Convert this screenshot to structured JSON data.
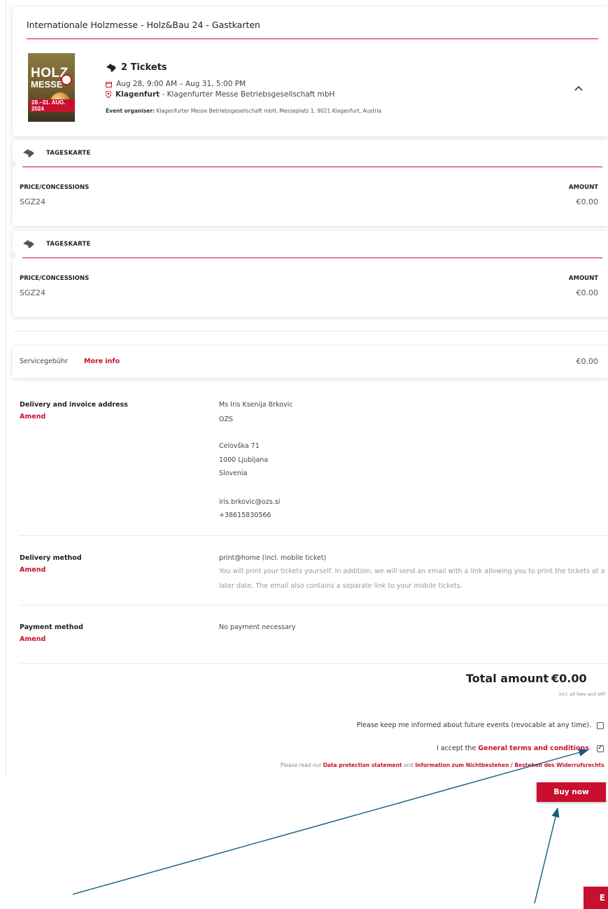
{
  "event": {
    "title": "Internationale Holzmesse - Holz&Bau 24 - Gastkarten",
    "poster": {
      "line1": "HOLZ",
      "line2": "MESSE",
      "date": "28.–31. AUG. 2024"
    },
    "tickets_count": "2 Tickets",
    "date_range": "Aug 28, 9:00 AM – Aug 31, 5:00 PM",
    "location_city": "Klagenfurt",
    "location_venue": " - Klagenfurter Messe Betriebsgesellschaft mbH",
    "organiser_label": "Event organiser:",
    "organiser_value": " Klagenfurter Messe Betriebsgesellschaft mbH, Messeplatz 1, 9021 Klagenfurt, Austria",
    "collapse_icon": "chevron-up-icon"
  },
  "tickets": [
    {
      "name": "TAGESKARTE",
      "price_label": "PRICE/CONCESSIONS",
      "price_value": "SGZ24",
      "amount_label": "AMOUNT",
      "amount_value": "€0.00"
    },
    {
      "name": "TAGESKARTE",
      "price_label": "PRICE/CONCESSIONS",
      "price_value": "SGZ24",
      "amount_label": "AMOUNT",
      "amount_value": "€0.00"
    }
  ],
  "service_fee": {
    "label": "Servicegebühr",
    "more_info": "More info",
    "value": "€0.00"
  },
  "delivery_address": {
    "label": "Delivery and invoice address",
    "amend": "Amend",
    "name": "Ms Iris Ksenija Brkovic",
    "company": "OZS",
    "street": "Celovška 71",
    "city": "1000 Ljubljana",
    "country": "Slovenia",
    "email": "iris.brkovic@ozs.si",
    "phone": "+38615830566"
  },
  "delivery_method": {
    "label": "Delivery method",
    "amend": "Amend",
    "value": "print@home (incl. mobile ticket)",
    "description": "You will print your tickets yourself. In addition, we will send an email with a link allowing you to print the tickets at a later date. The email also contains a separate link to your mobile tickets."
  },
  "payment_method": {
    "label": "Payment method",
    "amend": "Amend",
    "value": "No payment necessary"
  },
  "total": {
    "label": "Total amount",
    "value": "€0.00",
    "note": "incl. all fees and VAT"
  },
  "consent": {
    "newsletter": "Please keep me informed about future events (revocable at any time).",
    "terms_prefix": "I accept the ",
    "terms_link": "General terms and conditions",
    "terms_suffix": ".",
    "privacy_prefix": "Please read our ",
    "privacy_link": "Data protection statement",
    "privacy_and": " and ",
    "withdrawal_link": "Information zum Nichtbestehen / Bestehen des Widerrufsrechts",
    "privacy_suffix": "."
  },
  "buy_button": "Buy now",
  "corner_button": "E",
  "colors": {
    "accent": "#c8102e",
    "annotation": "#0f5c80"
  }
}
